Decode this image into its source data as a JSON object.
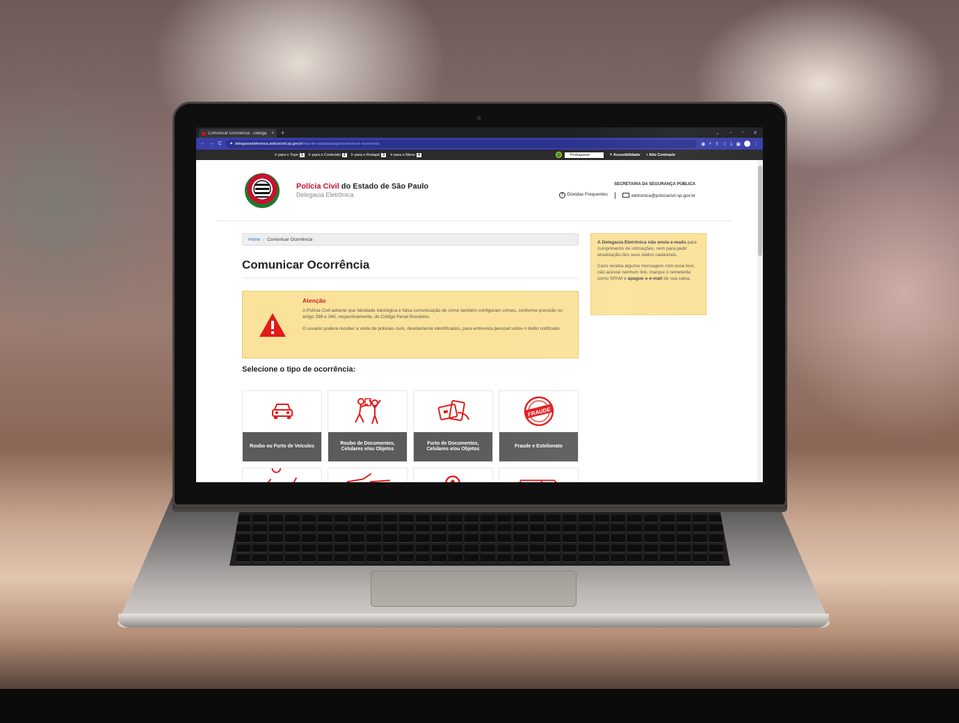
{
  "browser": {
    "tab_title": "Comunicar Ocorrência - Delega",
    "tab_close": "×",
    "new_tab": "+",
    "url_host": "delegaciaeletronica.policiacivil.sp.gov.br",
    "url_path": "/ssp-de-cidadao/pages/comunicar-ocorrencia"
  },
  "accessibility_bar": {
    "skip_links": [
      {
        "label": "Ir para o Topo",
        "num": "1"
      },
      {
        "label": "Ir para o Conteúdo",
        "num": "2"
      },
      {
        "label": "Ir para o Rodapé",
        "num": "3"
      },
      {
        "label": "Ir para o Menu",
        "num": "4"
      }
    ],
    "language_selected": "Portuguese",
    "accessibility_label": "Acessibilidade",
    "contrast_label": "Alto Contraste"
  },
  "header": {
    "title_highlight": "Polícia Civil",
    "title_rest": " do Estado de São Paulo",
    "subtitle": "Delegacia Eletrônica",
    "secretaria": "SECRETARIA DA SEGURANÇA PÚBLICA",
    "faq_label": "Dúvidas Frequentes",
    "email": "eletronica@policiacivil.sp.gov.br"
  },
  "breadcrumb": {
    "home": "Home",
    "separator": "/",
    "current": "Comunicar Ocorrência"
  },
  "main": {
    "page_title": "Comunicar Ocorrência",
    "select_title": "Selecione o tipo de ocorrência:"
  },
  "alert": {
    "title": "Atenção",
    "paragraph_1": "A Polícia Civil adverte que falsidade ideológica e falsa comunicação de crime também configuram crimes, conforme previsão no artigo 299 e 340, respectivamente, do Código Penal Brasileiro.",
    "paragraph_2": "O usuário poderá receber a visita de policiais civis, devidamente identificados, para entrevista pessoal sobre o delito notificado"
  },
  "cards": [
    {
      "label": "Roubo ou Furto de Veículos",
      "icon": "car-icon"
    },
    {
      "label": "Roubo de Documentos, Celulares e/ou Objetos",
      "icon": "robbery-icon"
    },
    {
      "label": "Furto de Documentos, Celulares e/ou Objetos",
      "icon": "cards-theft-icon"
    },
    {
      "label": "Fraude e Estelionato",
      "icon": "fraud-stamp-icon",
      "stamp_text": "FRAUDE"
    }
  ],
  "sidebar_notice": {
    "p1_bold": "A Delegacia Eletrônica não envia e-mails",
    "p1_rest": " para cumprimento de intimações, nem para pedir atualização dos seus dados cadastrais.",
    "p2_start": "Caso receba alguma mensagem com esse teor, não acesse nenhum link, marque o remetente como SPAM e ",
    "p2_bold": "apague o e-mail",
    "p2_end": " de sua caixa."
  },
  "colors": {
    "brand_red": "#c8102e",
    "alert_yellow": "#fbe29b",
    "card_label_bg": "#5b5b5b",
    "browser_bar": "#3a3fa8"
  }
}
